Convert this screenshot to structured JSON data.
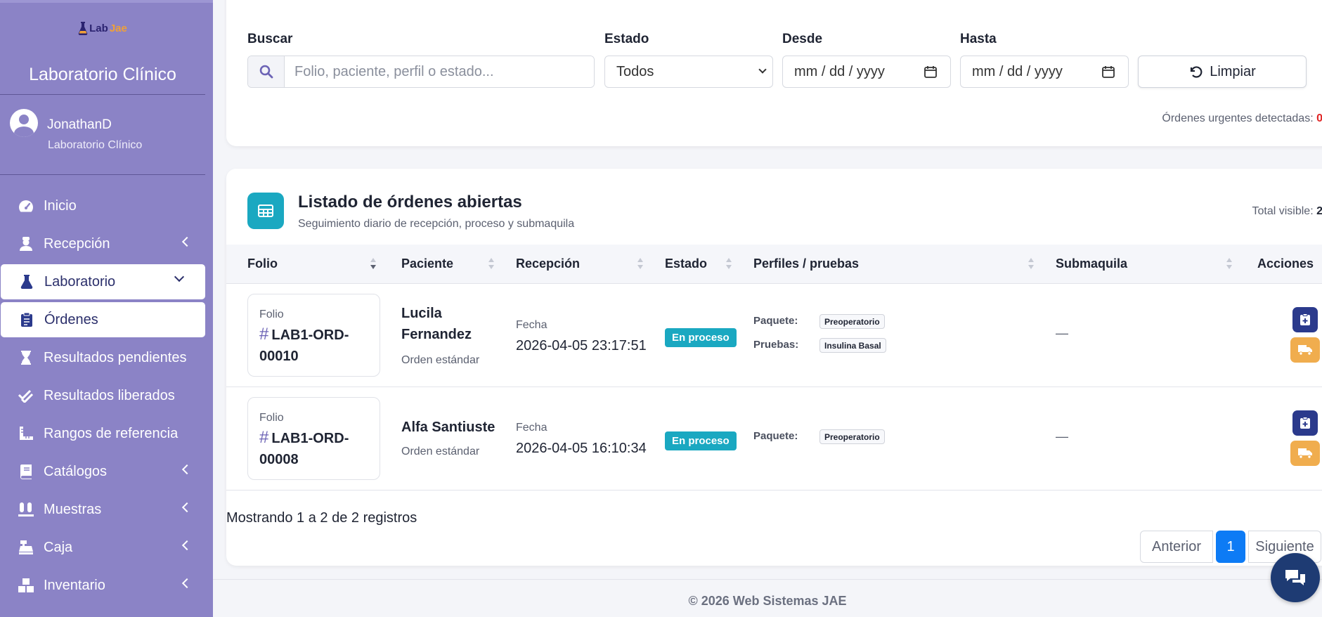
{
  "sidebar": {
    "brand": {
      "logo_lab": "Lab",
      "logo_jae": "Jae",
      "title": "Laboratorio Clínico"
    },
    "user": {
      "name": "JonathanD",
      "role": "Laboratorio Clínico"
    },
    "items": [
      {
        "label": "Inicio",
        "icon": "gauge-icon"
      },
      {
        "label": "Recepción",
        "icon": "user-nurse-icon",
        "submenu": true
      },
      {
        "label": "Laboratorio",
        "icon": "flask-icon",
        "submenu": true,
        "open": true
      },
      {
        "label": "Órdenes",
        "icon": "clipboard-list-icon",
        "active": true
      },
      {
        "label": "Resultados pendientes",
        "icon": "hourglass-icon"
      },
      {
        "label": "Resultados liberados",
        "icon": "double-check-icon"
      },
      {
        "label": "Rangos de referencia",
        "icon": "ruler-icon"
      },
      {
        "label": "Catálogos",
        "icon": "book-icon",
        "submenu": true
      },
      {
        "label": "Muestras",
        "icon": "vials-icon",
        "submenu": true
      },
      {
        "label": "Caja",
        "icon": "cash-register-icon",
        "submenu": true
      },
      {
        "label": "Inventario",
        "icon": "boxes-icon",
        "submenu": true
      }
    ]
  },
  "filters": {
    "search_label": "Buscar",
    "search_placeholder": "Folio, paciente, perfil o estado...",
    "status_label": "Estado",
    "status_value": "Todos",
    "from_label": "Desde",
    "from_value": "mm / dd / yyyy",
    "to_label": "Hasta",
    "to_value": "mm / dd / yyyy",
    "clear_label": "Limpiar",
    "urgent_text": "Órdenes urgentes detectadas:",
    "urgent_count": "0"
  },
  "list": {
    "title": "Listado de órdenes abiertas",
    "subtitle": "Seguimiento diario de recepción, proceso y submaquila",
    "total_label": "Total visible:",
    "total_value": "2",
    "columns": [
      "Folio",
      "Paciente",
      "Recepción",
      "Estado",
      "Perfiles / pruebas",
      "Submaquila",
      "Acciones"
    ],
    "rows": [
      {
        "folio_label": "Folio",
        "folio": "LAB1-ORD-00010",
        "patient": "Lucila Fernandez",
        "order_type": "Orden estándar",
        "date_label": "Fecha",
        "date": "2026-04-05 23:17:51",
        "status": "En proceso",
        "package_label": "Paquete:",
        "package": "Preoperatorio",
        "tests_label": "Pruebas:",
        "tests": "Insulina Basal",
        "submaquila": "—"
      },
      {
        "folio_label": "Folio",
        "folio": "LAB1-ORD-00008",
        "patient": "Alfa Santiuste",
        "order_type": "Orden estándar",
        "date_label": "Fecha",
        "date": "2026-04-05 16:10:34",
        "status": "En proceso",
        "package_label": "Paquete:",
        "package": "Preoperatorio",
        "submaquila": "—"
      }
    ],
    "showing": "Mostrando 1 a 2 de 2 registros",
    "pagination": {
      "prev": "Anterior",
      "current": "1",
      "next": "Siguiente"
    }
  },
  "footer": {
    "text": "© 2026 Web Sistemas JAE"
  },
  "colors": {
    "sidebar": "#8b83c6",
    "accent_teal": "#1aa8c1",
    "primary_navy": "#2b3a8c",
    "warning": "#f0ad4e",
    "page_blue": "#0d7bf5",
    "urgent_red": "#e02424"
  }
}
